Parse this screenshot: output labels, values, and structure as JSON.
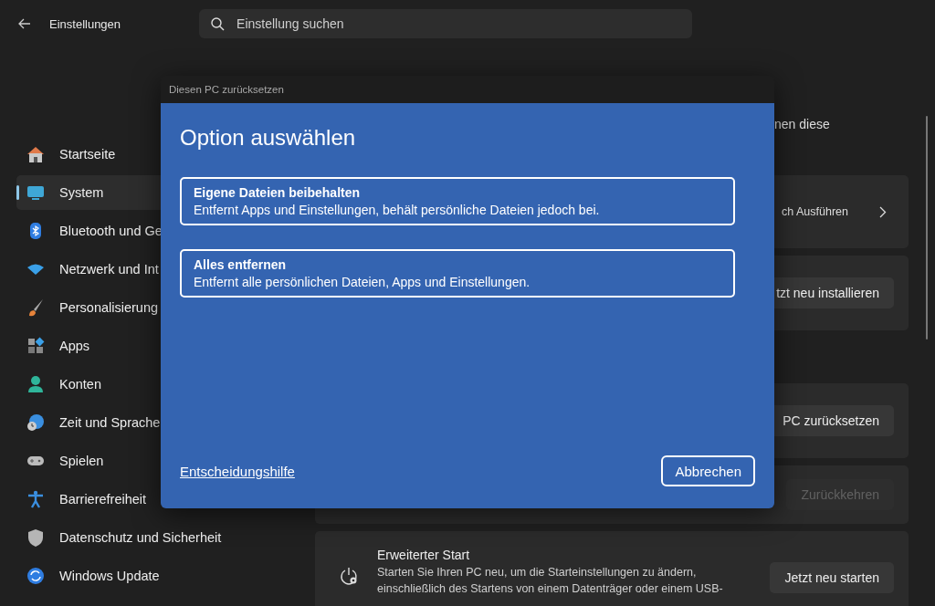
{
  "window": {
    "title": "Einstellungen"
  },
  "search": {
    "placeholder": "Einstellung suchen"
  },
  "sidebar": {
    "items": [
      {
        "label": "Startseite",
        "selected": false
      },
      {
        "label": "System",
        "selected": true
      },
      {
        "label": "Bluetooth und Ge",
        "selected": false
      },
      {
        "label": "Netzwerk und Int",
        "selected": false
      },
      {
        "label": "Personalisierung",
        "selected": false
      },
      {
        "label": "Apps",
        "selected": false
      },
      {
        "label": "Konten",
        "selected": false
      },
      {
        "label": "Zeit und Sprache",
        "selected": false
      },
      {
        "label": "Spielen",
        "selected": false
      },
      {
        "label": "Barrierefreiheit",
        "selected": false
      },
      {
        "label": "Datenschutz und Sicherheit",
        "selected": false
      },
      {
        "label": "Windows Update",
        "selected": false
      }
    ]
  },
  "content": {
    "intro": "nen diese",
    "cards": [
      {
        "kind": "link",
        "text": "ch Ausführen"
      },
      {
        "kind": "button",
        "button": "tzt neu installieren",
        "disabled": false
      },
      {
        "kind": "button",
        "button": "PC zurücksetzen",
        "disabled": false
      },
      {
        "kind": "button",
        "button": "Zurückkehren",
        "disabled": true
      },
      {
        "kind": "button",
        "title": "Erweiterter Start",
        "description": "Starten Sie Ihren PC neu, um die Starteinstellungen zu ändern, einschließlich des Startens von einem Datenträger oder einem USB-",
        "button": "Jetzt neu starten",
        "disabled": false
      }
    ]
  },
  "dialog": {
    "title": "Diesen PC zurücksetzen",
    "heading": "Option auswählen",
    "options": [
      {
        "title": "Eigene Dateien beibehalten",
        "description": "Entfernt Apps und Einstellungen, behält persönliche Dateien jedoch bei."
      },
      {
        "title": "Alles entfernen",
        "description": "Entfernt alle persönlichen Dateien, Apps und Einstellungen."
      }
    ],
    "help_link": "Entscheidungshilfe",
    "cancel": "Abbrechen"
  }
}
